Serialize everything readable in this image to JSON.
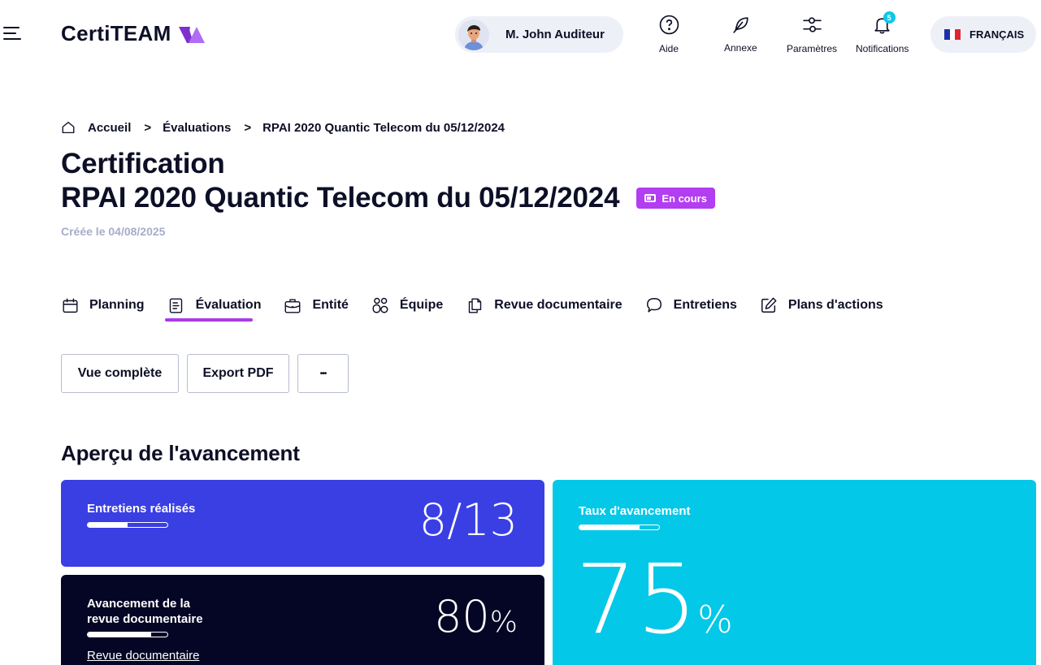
{
  "header": {
    "logo_text": "CertiTEAM",
    "user_name": "M. John Auditeur",
    "buttons": {
      "help": "Aide",
      "annex": "Annexe",
      "settings": "Paramètres",
      "notifications": "Notifications"
    },
    "notification_count": "5",
    "language": "FRANÇAIS",
    "accent_color": "#b33df0",
    "badge_color": "#12c6e6"
  },
  "breadcrumb": {
    "home": "Accueil",
    "separator": ">",
    "evaluations": "Évaluations",
    "current": "RPAI 2020 Quantic Telecom du 05/12/2024"
  },
  "page": {
    "title_line1": "Certification",
    "title_line2": "RPAI 2020 Quantic Telecom du 05/12/2024",
    "status": "En cours",
    "created": "Créée le 04/08/2025"
  },
  "tabs": [
    {
      "label": "Planning",
      "icon": "calendar-icon"
    },
    {
      "label": "Évaluation",
      "icon": "document-icon",
      "active": true
    },
    {
      "label": "Entité",
      "icon": "briefcase-icon"
    },
    {
      "label": "Équipe",
      "icon": "team-icon"
    },
    {
      "label": "Revue documentaire",
      "icon": "copy-icon"
    },
    {
      "label": "Entretiens",
      "icon": "chat-bubble-icon"
    },
    {
      "label": "Plans d'actions",
      "icon": "edit-icon"
    }
  ],
  "actions": {
    "full_view": "Vue complète",
    "export_pdf": "Export PDF",
    "more": "•••"
  },
  "overview": {
    "title": "Aperçu de l'avancement",
    "interviews": {
      "label": "Entretiens réalisés",
      "value": "8/13",
      "progress": 0.5,
      "color": "#3a3fe4"
    },
    "doc_review": {
      "label_line1": "Avancement de la",
      "label_line2": "revue documentaire",
      "value": "80",
      "unit": "%",
      "progress": 0.8,
      "link": "Revue documentaire",
      "color": "#050625"
    },
    "rate": {
      "label": "Taux d'avancement",
      "value": "75",
      "unit": "%",
      "progress": 0.75,
      "color": "#03c8e8"
    }
  }
}
